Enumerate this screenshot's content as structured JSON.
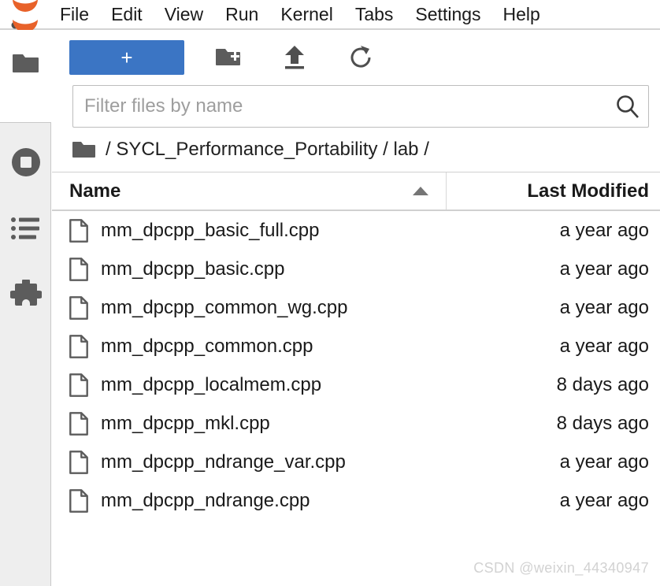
{
  "menubar": {
    "logo_name": "jupyter-logo",
    "items": [
      {
        "label": "File"
      },
      {
        "label": "Edit"
      },
      {
        "label": "View"
      },
      {
        "label": "Run"
      },
      {
        "label": "Kernel"
      },
      {
        "label": "Tabs"
      },
      {
        "label": "Settings"
      },
      {
        "label": "Help"
      }
    ]
  },
  "activitybar": {
    "items": [
      {
        "name": "file-browser-icon",
        "selected": true
      },
      {
        "name": "running-terminals-icon",
        "selected": false
      },
      {
        "name": "table-of-contents-icon",
        "selected": false
      },
      {
        "name": "extension-manager-icon",
        "selected": false
      }
    ]
  },
  "toolbar": {
    "new_launcher_label": "+",
    "new_folder_title": "New Folder",
    "upload_title": "Upload Files",
    "refresh_title": "Refresh File List"
  },
  "filter": {
    "value": "",
    "placeholder": "Filter files by name"
  },
  "breadcrumb": {
    "path": "/ SYCL_Performance_Portability / lab /"
  },
  "table": {
    "columns": {
      "name": "Name",
      "last_modified": "Last Modified"
    },
    "sort": "ascending",
    "rows": [
      {
        "name": "mm_dpcpp_basic_full.cpp",
        "modified": "a year ago"
      },
      {
        "name": "mm_dpcpp_basic.cpp",
        "modified": "a year ago"
      },
      {
        "name": "mm_dpcpp_common_wg.cpp",
        "modified": "a year ago"
      },
      {
        "name": "mm_dpcpp_common.cpp",
        "modified": "a year ago"
      },
      {
        "name": "mm_dpcpp_localmem.cpp",
        "modified": "8 days ago"
      },
      {
        "name": "mm_dpcpp_mkl.cpp",
        "modified": "8 days ago"
      },
      {
        "name": "mm_dpcpp_ndrange_var.cpp",
        "modified": "a year ago"
      },
      {
        "name": "mm_dpcpp_ndrange.cpp",
        "modified": "a year ago"
      }
    ]
  },
  "watermark": {
    "text": "CSDN @weixin_44340947"
  },
  "colors": {
    "accent_blue": "#3b75c4",
    "logo_orange": "#e8622a",
    "icon_gray": "#616161",
    "sidebar_gray": "#eeeeee"
  }
}
